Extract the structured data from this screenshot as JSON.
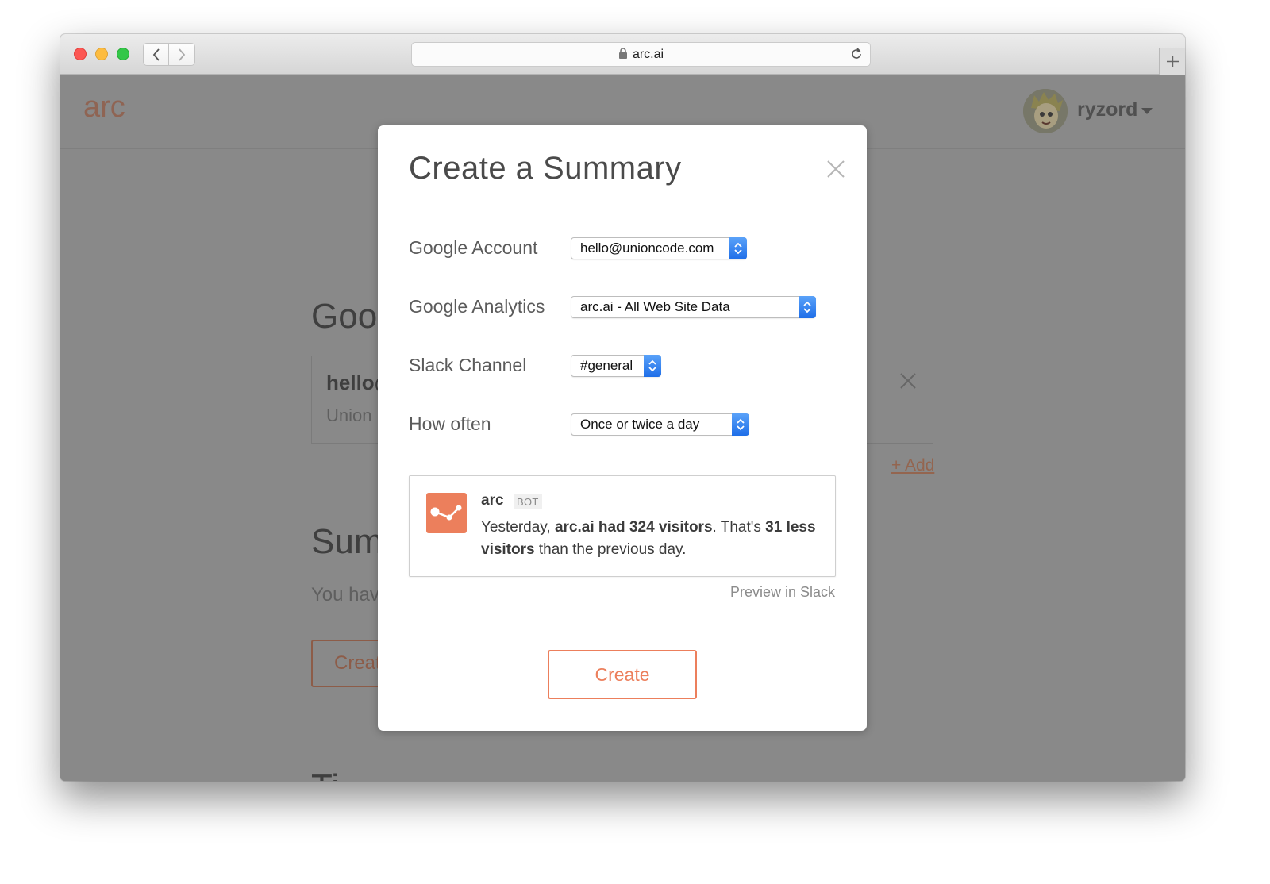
{
  "browser": {
    "url": "arc.ai"
  },
  "app": {
    "logo": "arc",
    "user": {
      "name": "ryzord"
    }
  },
  "background": {
    "heading_google": "Goo",
    "account_card": {
      "email": "hello@",
      "org": "Union"
    },
    "add_link": "+ Add",
    "heading_summaries": "Sum",
    "summaries_text": "You hav",
    "create_button": "Creat",
    "heading_third": "Ti"
  },
  "modal": {
    "title": "Create a Summary",
    "fields": {
      "google_account": {
        "label": "Google Account",
        "value": "hello@unioncode.com"
      },
      "google_analytics": {
        "label": "Google Analytics",
        "value": "arc.ai - All Web Site Data"
      },
      "slack_channel": {
        "label": "Slack Channel",
        "value": "#general"
      },
      "how_often": {
        "label": "How often",
        "value": "Once or twice a day"
      }
    },
    "preview": {
      "bot_name": "arc",
      "bot_badge": "BOT",
      "msg_1": "Yesterday, ",
      "msg_2": "arc.ai had 324 visitors",
      "msg_3": ". That's ",
      "msg_4": "31 less visitors",
      "msg_5": " than the previous day."
    },
    "preview_link": "Preview in Slack",
    "create_label": "Create"
  },
  "colors": {
    "accent": "#ec7f5c",
    "select_blue": "#1e6ee8",
    "overlay": "#898989"
  }
}
